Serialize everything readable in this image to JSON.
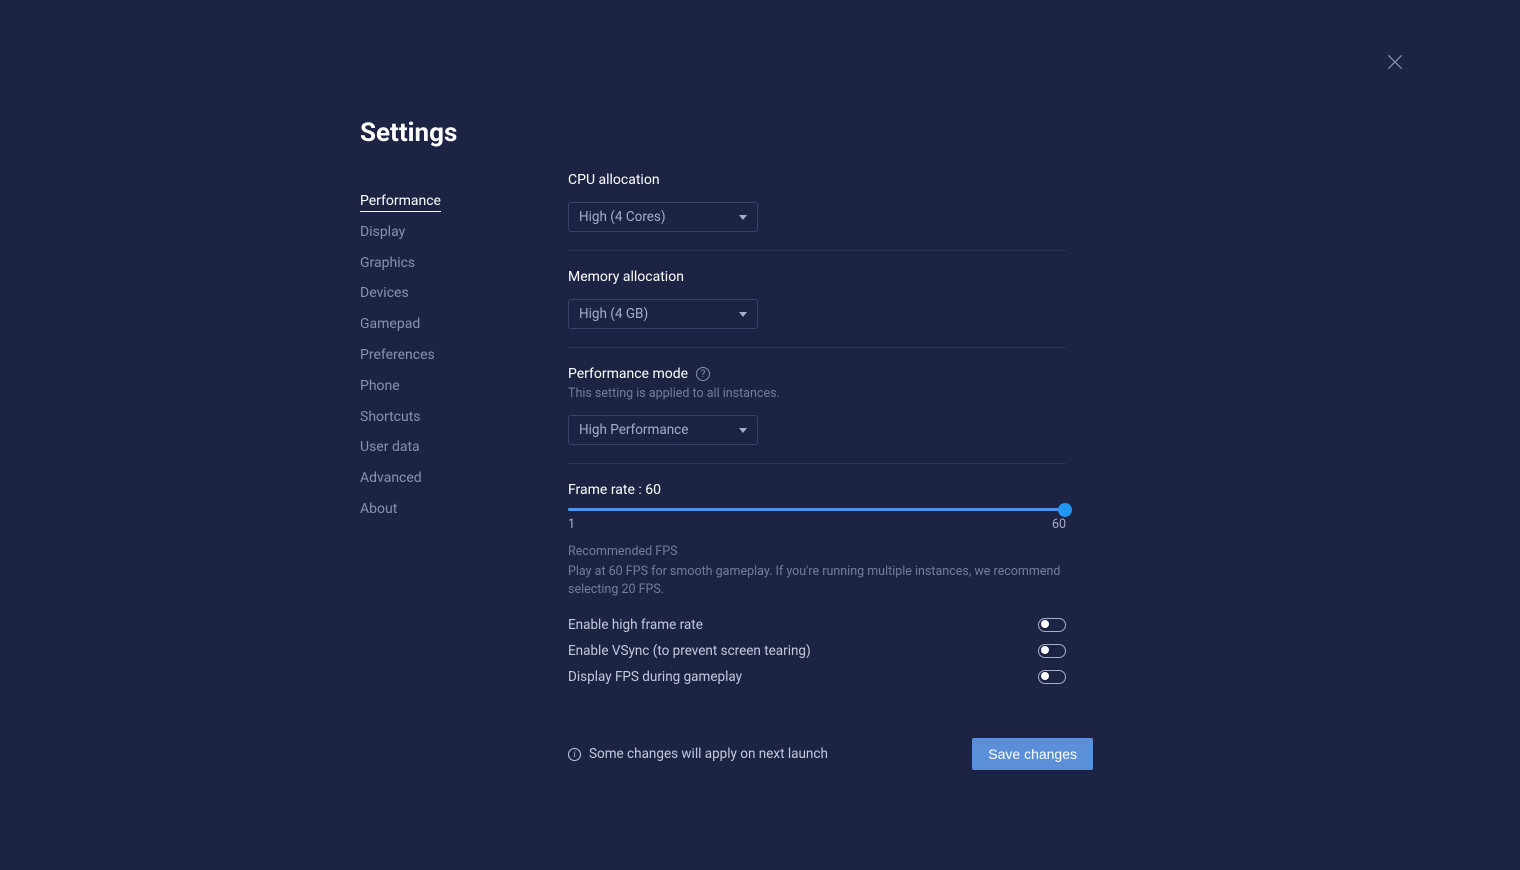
{
  "page_title": "Settings",
  "sidebar": {
    "items": [
      {
        "label": "Performance",
        "active": true
      },
      {
        "label": "Display",
        "active": false
      },
      {
        "label": "Graphics",
        "active": false
      },
      {
        "label": "Devices",
        "active": false
      },
      {
        "label": "Gamepad",
        "active": false
      },
      {
        "label": "Preferences",
        "active": false
      },
      {
        "label": "Phone",
        "active": false
      },
      {
        "label": "Shortcuts",
        "active": false
      },
      {
        "label": "User data",
        "active": false
      },
      {
        "label": "Advanced",
        "active": false
      },
      {
        "label": "About",
        "active": false
      }
    ]
  },
  "cpu": {
    "label": "CPU allocation",
    "value": "High (4 Cores)"
  },
  "memory": {
    "label": "Memory allocation",
    "value": "High (4 GB)"
  },
  "perfmode": {
    "label": "Performance mode",
    "subtext": "This setting is applied to all instances.",
    "value": "High Performance"
  },
  "framerate": {
    "label_prefix": "Frame rate : ",
    "value": "60",
    "min": "1",
    "max": "60",
    "rec_title": "Recommended FPS",
    "rec_body": "Play at 60 FPS for smooth gameplay. If you're running multiple instances, we recommend selecting 20 FPS."
  },
  "toggles": {
    "high_frame": "Enable high frame rate",
    "vsync": "Enable VSync (to prevent screen tearing)",
    "display_fps": "Display FPS during gameplay"
  },
  "footer": {
    "note": "Some changes will apply on next launch",
    "save": "Save changes"
  }
}
